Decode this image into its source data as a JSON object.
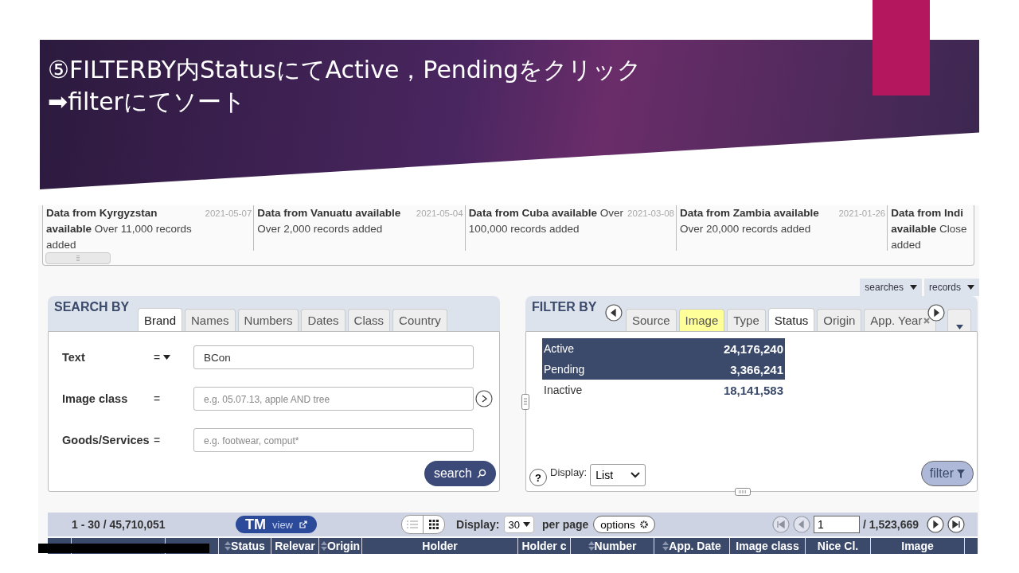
{
  "slide": {
    "title_lines": [
      "⑤FILTERBY内StatusにてActive，Pendingをクリック",
      "➡filterにてソート"
    ]
  },
  "news": [
    {
      "text": "**Data from Kyrgyzstan available** Over 11,000 records added",
      "date": "2021-05-07"
    },
    {
      "text": "**Data from Vanuatu available** Over 2,000 records added",
      "date": "2021-05-04"
    },
    {
      "text": "**Data from Cuba available** Over 100,000 records added",
      "date": "2021-03-08"
    },
    {
      "text": "**Data from Zambia available** Over 20,000 records added",
      "date": "2021-01-26"
    },
    {
      "text": "**Data from Indi available** Close added"
    }
  ],
  "top_menus": [
    "searches",
    "records"
  ],
  "search": {
    "title": "SEARCH BY",
    "tabs": [
      {
        "label": "Brand",
        "selected": true
      },
      {
        "label": "Names",
        "selected": false
      },
      {
        "label": "Numbers",
        "selected": false
      },
      {
        "label": "Dates",
        "selected": false
      },
      {
        "label": "Class",
        "selected": false
      },
      {
        "label": "Country",
        "selected": false
      }
    ],
    "fields": [
      {
        "label": "Text",
        "operator": "=",
        "value": "BCon"
      },
      {
        "label": "Image class",
        "operator": "=",
        "placeholder": "e.g. 05.07.13, apple AND tree"
      },
      {
        "label": "Goods/Services",
        "operator": "=",
        "placeholder": "e.g. footwear, comput*"
      }
    ],
    "button": "search"
  },
  "filter": {
    "title": "FILTER BY",
    "tabs": [
      {
        "label": "Source",
        "selected": false,
        "highlighted": false,
        "removable": false
      },
      {
        "label": "Image",
        "selected": false,
        "highlighted": true,
        "removable": false
      },
      {
        "label": "Type",
        "selected": false,
        "highlighted": false,
        "removable": false
      },
      {
        "label": "Status",
        "selected": true,
        "highlighted": false,
        "removable": false
      },
      {
        "label": "Origin",
        "selected": false,
        "highlighted": false,
        "removable": false
      },
      {
        "label": "App. Year",
        "selected": false,
        "highlighted": false,
        "removable": true
      }
    ],
    "rows": [
      {
        "label": "Active",
        "count": "24,176,240",
        "selected": true
      },
      {
        "label": "Pending",
        "count": "3,366,241",
        "selected": true
      },
      {
        "label": "Inactive",
        "count": "18,141,583",
        "selected": false
      }
    ],
    "help": "?",
    "display_label": "Display:",
    "display_value": "List",
    "button": "filter"
  },
  "results": {
    "range": "1 - 30 / 45,710,051",
    "tmview": {
      "brand": "TM",
      "suffix": "view"
    },
    "display_label": "Display:",
    "per_page_value": "30",
    "per_page_label": "per page",
    "options": "options",
    "page": "1",
    "pages": "/ 1,523,669",
    "columns": [
      {
        "label": "Status",
        "sortable": true
      },
      {
        "label": "Relevar",
        "sortable": false
      },
      {
        "label": "Origin",
        "sortable": true
      },
      {
        "label": "Holder",
        "sortable": false
      },
      {
        "label": "Holder c",
        "sortable": false
      },
      {
        "label": "Number",
        "sortable": true
      },
      {
        "label": "App. Date",
        "sortable": true
      },
      {
        "label": "Image class",
        "sortable": false
      },
      {
        "label": "Nice Cl.",
        "sortable": false
      },
      {
        "label": "Image",
        "sortable": false
      }
    ]
  }
}
